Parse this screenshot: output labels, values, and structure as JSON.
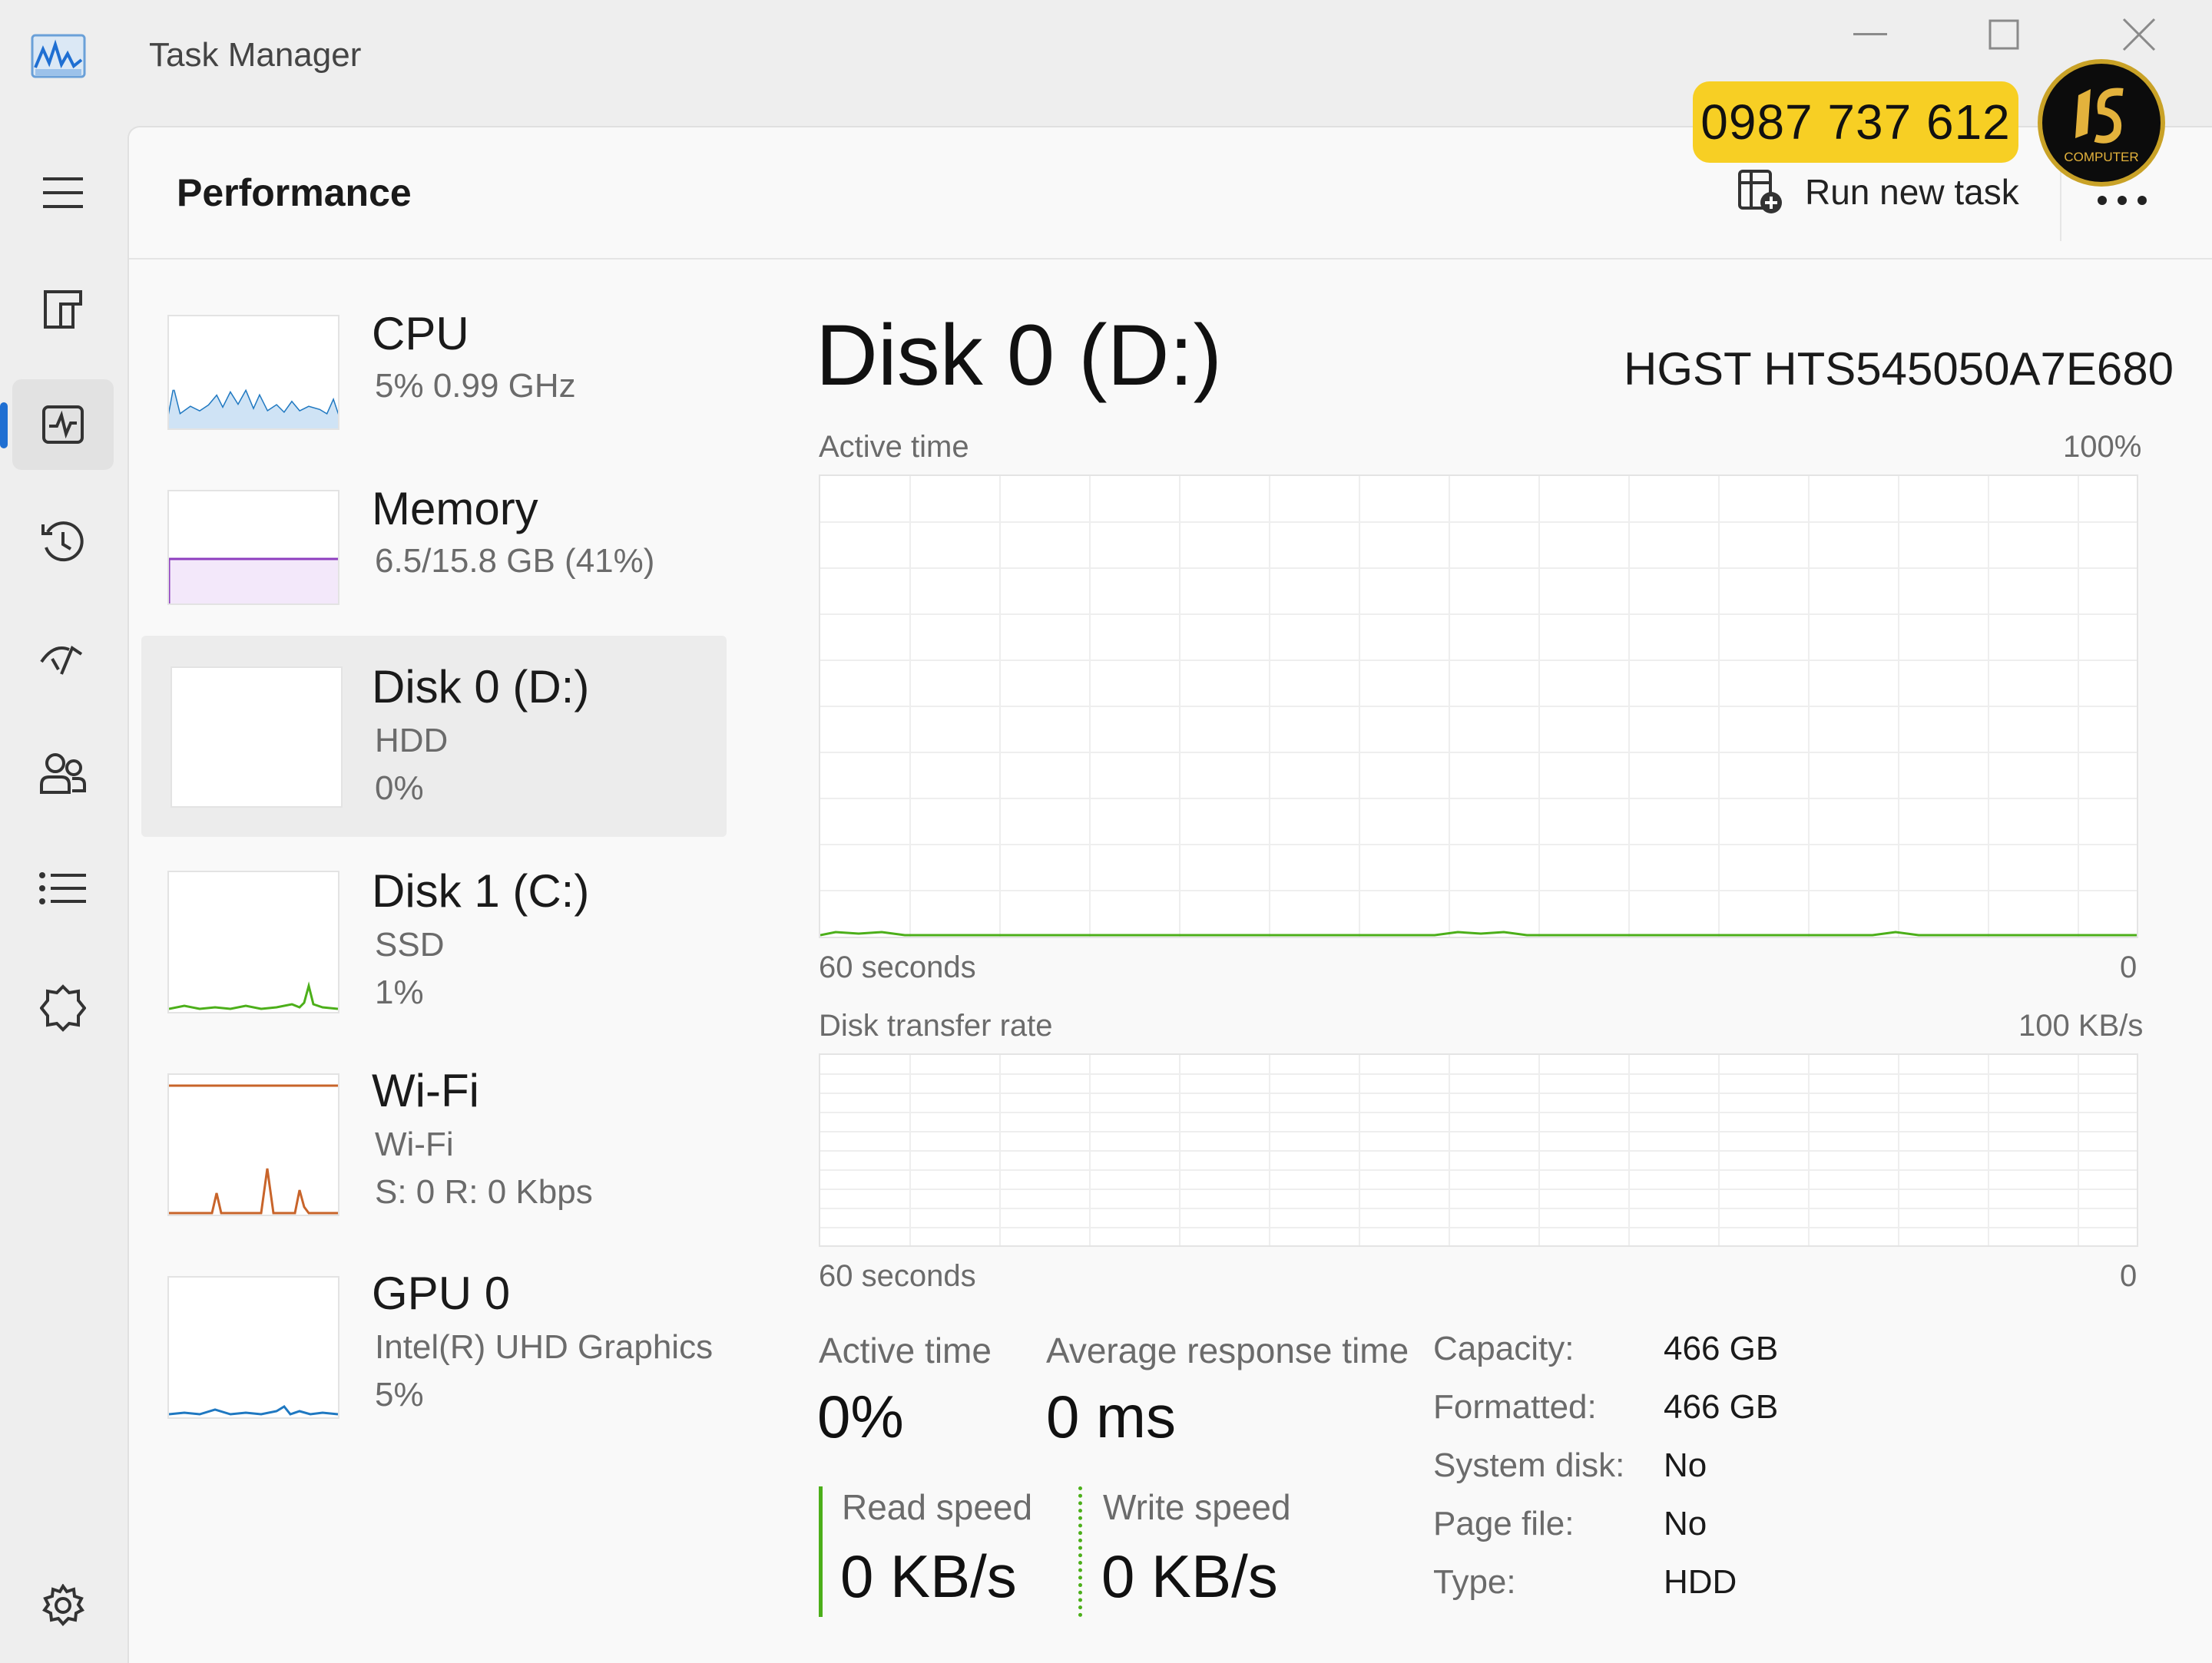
{
  "window": {
    "title": "Task Manager"
  },
  "header": {
    "page_title": "Performance",
    "run_new_task": "Run new task",
    "more": "•••"
  },
  "overlay": {
    "phone": "0987 737 612",
    "logo_text": "COMPUTER"
  },
  "nav": [
    {
      "icon": "hamburger-menu-icon"
    },
    {
      "icon": "processes-icon"
    },
    {
      "icon": "performance-icon",
      "active": true
    },
    {
      "icon": "app-history-icon"
    },
    {
      "icon": "startup-apps-icon"
    },
    {
      "icon": "users-icon"
    },
    {
      "icon": "details-icon"
    },
    {
      "icon": "services-icon"
    },
    {
      "icon": "settings-icon"
    }
  ],
  "resources": [
    {
      "name": "CPU",
      "line1": "5%  0.99 GHz",
      "line2": "",
      "color": "#1f78c1"
    },
    {
      "name": "Memory",
      "line1": "6.5/15.8 GB (41%)",
      "line2": "",
      "color": "#8e3ebf"
    },
    {
      "name": "Disk 0 (D:)",
      "line1": "HDD",
      "line2": "0%",
      "color": "#4caf1a",
      "selected": true
    },
    {
      "name": "Disk 1 (C:)",
      "line1": "SSD",
      "line2": "1%",
      "color": "#4caf1a"
    },
    {
      "name": "Wi-Fi",
      "line1": "Wi-Fi",
      "line2": "S: 0  R: 0 Kbps",
      "color": "#c8642a"
    },
    {
      "name": "GPU 0",
      "line1": "Intel(R) UHD Graphics",
      "line2": "5%",
      "color": "#1f78c1"
    }
  ],
  "detail": {
    "title": "Disk 0 (D:)",
    "model": "HGST HTS545050A7E680",
    "active_time_graph": {
      "label": "Active time",
      "max": "100%",
      "time": "60 seconds",
      "min": "0"
    },
    "transfer_graph": {
      "label": "Disk transfer rate",
      "max": "100 KB/s",
      "time": "60 seconds",
      "min": "0"
    },
    "stats": {
      "active_time_label": "Active time",
      "active_time_value": "0%",
      "response_label": "Average response time",
      "response_value": "0 ms",
      "read_label": "Read speed",
      "read_value": "0 KB/s",
      "write_label": "Write speed",
      "write_value": "0 KB/s"
    },
    "properties": [
      {
        "key": "Capacity:",
        "value": "466 GB"
      },
      {
        "key": "Formatted:",
        "value": "466 GB"
      },
      {
        "key": "System disk:",
        "value": "No"
      },
      {
        "key": "Page file:",
        "value": "No"
      },
      {
        "key": "Type:",
        "value": "HDD"
      }
    ]
  },
  "colors": {
    "accent": "#1f6fd2",
    "disk": "#4caf1a",
    "badge": "#f7cf24"
  }
}
